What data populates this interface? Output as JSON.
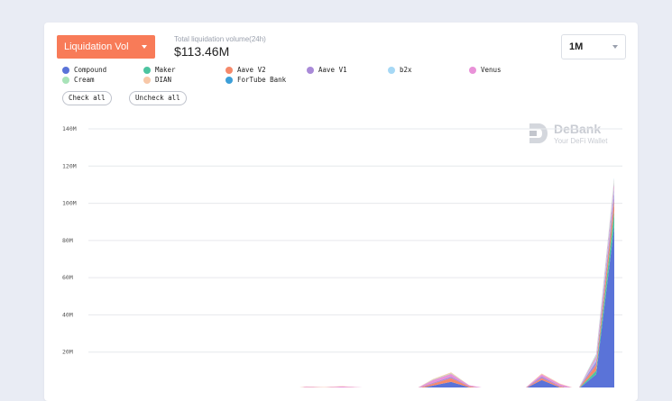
{
  "header": {
    "metric_label": "Liquidation Vol",
    "total_label": "Total liquidation volume(24h)",
    "total_value": "$113.46M",
    "range_label": "1M"
  },
  "legend": [
    {
      "name": "Compound",
      "color": "#5a73d8"
    },
    {
      "name": "Maker",
      "color": "#4dc4a0"
    },
    {
      "name": "Aave V2",
      "color": "#f5896a"
    },
    {
      "name": "Aave V1",
      "color": "#a98ad8"
    },
    {
      "name": "b2x",
      "color": "#a6d8f5"
    },
    {
      "name": "Venus",
      "color": "#e992d8"
    },
    {
      "name": "Cream",
      "color": "#a8e3b8"
    },
    {
      "name": "DIAN",
      "color": "#f8c8a8"
    },
    {
      "name": "ForTube Bank",
      "color": "#3d9fd8"
    }
  ],
  "controls": {
    "check_all": "Check all",
    "uncheck_all": "Uncheck all"
  },
  "watermark": {
    "name": "DeBank",
    "tagline": "Your DeFi Wallet"
  },
  "chart_data": {
    "type": "area",
    "stacked": true,
    "y_ticks": [
      "140M",
      "120M",
      "100M",
      "80M",
      "60M",
      "40M",
      "20M"
    ],
    "ylim": [
      0,
      140
    ],
    "grid": true,
    "n_points": 30,
    "series": [
      {
        "name": "Compound",
        "color": "#5a73d8",
        "values": [
          0.8,
          0,
          0.2,
          0,
          0.6,
          0,
          0.6,
          0,
          0.4,
          0,
          0.2,
          0,
          0,
          0,
          0.2,
          0,
          0.2,
          0,
          0,
          2,
          4,
          1,
          0.2,
          0,
          0,
          5,
          1,
          0,
          8,
          88
        ]
      },
      {
        "name": "Maker",
        "color": "#4dc4a0",
        "values": [
          0,
          0,
          0,
          0,
          0,
          0,
          0,
          0,
          0,
          0,
          0,
          0,
          0,
          0,
          0,
          0,
          0,
          0,
          0,
          0,
          0,
          0,
          0,
          0,
          0,
          0,
          0,
          0,
          2,
          8
        ]
      },
      {
        "name": "Aave V2",
        "color": "#f5896a",
        "values": [
          0,
          0,
          0.2,
          0,
          0,
          0,
          0,
          0,
          0,
          0,
          0,
          0,
          0.3,
          0.4,
          0.3,
          0.2,
          0,
          0,
          0,
          1,
          2,
          0.5,
          0,
          0,
          0,
          1,
          0.5,
          0,
          3,
          6
        ]
      },
      {
        "name": "Aave V1",
        "color": "#a98ad8",
        "values": [
          0,
          0,
          0,
          0,
          0,
          0,
          0,
          0,
          0,
          0,
          0,
          0,
          0.2,
          0,
          0,
          0,
          0,
          0,
          0,
          0.5,
          0.8,
          0.2,
          0,
          0,
          0,
          1,
          0.3,
          0,
          2,
          4
        ]
      },
      {
        "name": "b2x",
        "color": "#a6d8f5",
        "values": [
          0,
          0,
          0,
          0,
          0,
          0,
          0,
          0,
          0,
          0,
          0,
          0,
          0,
          0,
          0,
          0,
          0,
          0,
          0,
          0,
          0,
          0,
          0,
          0,
          0,
          0,
          0,
          0,
          1,
          2
        ]
      },
      {
        "name": "Venus",
        "color": "#e992d8",
        "values": [
          0,
          0,
          0.4,
          0,
          0.3,
          0,
          0.3,
          0,
          0.3,
          0,
          0.4,
          0,
          0.8,
          0.6,
          1,
          0.8,
          0.4,
          0,
          0,
          1.5,
          1.5,
          0.5,
          0.2,
          0,
          0,
          1,
          1,
          0,
          1.5,
          3
        ]
      },
      {
        "name": "Cream",
        "color": "#a8e3b8",
        "values": [
          0,
          0,
          0,
          0,
          0,
          0,
          0,
          0,
          0,
          0,
          0,
          0,
          0,
          0,
          0,
          0,
          0,
          0,
          0,
          0.2,
          0.3,
          0,
          0,
          0,
          0,
          0,
          0,
          0,
          0.5,
          1
        ]
      },
      {
        "name": "DIAN",
        "color": "#f8c8a8",
        "values": [
          0,
          0,
          0,
          0,
          0,
          0,
          0,
          0,
          0,
          0,
          0,
          0,
          0.2,
          0.2,
          0.2,
          0,
          0,
          0,
          0,
          0.3,
          0.5,
          0,
          0,
          0,
          0,
          0.5,
          0.3,
          0,
          0.5,
          1
        ]
      },
      {
        "name": "ForTube Bank",
        "color": "#3d9fd8",
        "values": [
          0,
          0,
          0,
          0,
          0,
          0,
          0,
          0,
          0,
          0,
          0,
          0,
          0,
          0,
          0,
          0,
          0,
          0,
          0,
          0,
          0,
          0,
          0,
          0,
          0,
          0,
          0,
          0,
          0.3,
          0.5
        ]
      }
    ]
  }
}
